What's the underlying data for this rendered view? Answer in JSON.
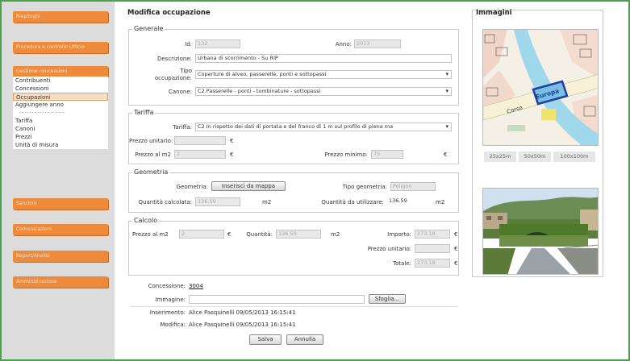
{
  "sidebar": {
    "buttons": [
      "Riepiloghi",
      "Procedura e controllo Ufficio",
      "Gestione concessioni",
      "Sanzioni",
      "Comunicazioni",
      "Report/Analisi",
      "Amministrazione"
    ],
    "menu": [
      "Contribuenti",
      "Concessioni",
      "Occupazioni",
      "Aggiungere anno",
      "------------------",
      "Tariffa",
      "Canoni",
      "Prezzi",
      "Unità di misura"
    ]
  },
  "main": {
    "title": "Modifica occupazione",
    "generale": {
      "legend": "Generale",
      "id_label": "Id:",
      "id_value": "132",
      "anno_label": "Anno:",
      "anno_value": "2013",
      "descrizione_label": "Descrizione:",
      "descrizione_value": "Urbana di scorrimento - Su RIP",
      "tipo_label_1": "Tipo",
      "tipo_label_2": "occupazione:",
      "tipo_value": "Coperture di alveo, passerelle, ponti e sottopassi",
      "canone_label": "Canone:",
      "canone_value": "C2 Passerelle - ponti - tombinature - sottopassi"
    },
    "tariffa": {
      "legend": "Tariffa",
      "tariffa_label": "Tariffa:",
      "tariffa_value": "C2 In rispetto dei dati di portata e del franco di 1 m sul profilo di piena ma",
      "prezzo_unitario_label": "Prezzo unitario:",
      "prezzo_unitario_value": "",
      "prezzo_m2_label": "Prezzo al m2",
      "prezzo_m2_value": "2",
      "prezzo_minimo_label": "Prezzo minimo:",
      "prezzo_minimo_value": "75",
      "currency": "€"
    },
    "geometria": {
      "legend": "Geometria",
      "geometria_label": "Geometria:",
      "inserisci_button": "Inserisci da mappa",
      "tipo_label": "Tipo geometria:",
      "tipo_value": "Poligon",
      "calcolata_label": "Quantità calcolata:",
      "calcolata_value": "136.59",
      "unit": "m2",
      "utilizzare_label": "Quantità da utilizzare:",
      "utilizzare_value": "136.59"
    },
    "calcolo": {
      "legend": "Calcolo",
      "prezzo_m2_label": "Prezzo al m2",
      "prezzo_m2_value": "2",
      "quantita_label": "Quantità:",
      "quantita_value": "136.59",
      "importo_label": "Importo:",
      "importo_value": "273.18",
      "prezzo_unitario_label": "Prezzo unitario:",
      "prezzo_unitario_value": "",
      "totale_label": "Totale:",
      "totale_value": "273.18",
      "unit": "m2",
      "currency": "€"
    },
    "footer": {
      "concessione_label": "Concessione:",
      "concessione_value": "3004",
      "immagine_label": "Immagine:",
      "sfoglia_button": "Sfoglia...",
      "inserimento_label": "Inserimento:",
      "inserimento_value": "Alice Pasquinelli 09/05/2013 16:15:41",
      "modifica_label": "Modifica:",
      "modifica_value": "Alice Pasquinelli 09/05/2013 16:15:41",
      "salva_button": "Salva",
      "annulla_button": "Annulla"
    }
  },
  "images": {
    "title": "Immagini",
    "map_labels": [
      "Corso",
      "Europa"
    ],
    "zoom_options": [
      "25x25m",
      "50x50m",
      "100x100m"
    ]
  },
  "colors": {
    "frame": "#4aa24a",
    "sidebar_button": "#ee8a3c",
    "sidebar_bg": "#dcdcdc"
  }
}
